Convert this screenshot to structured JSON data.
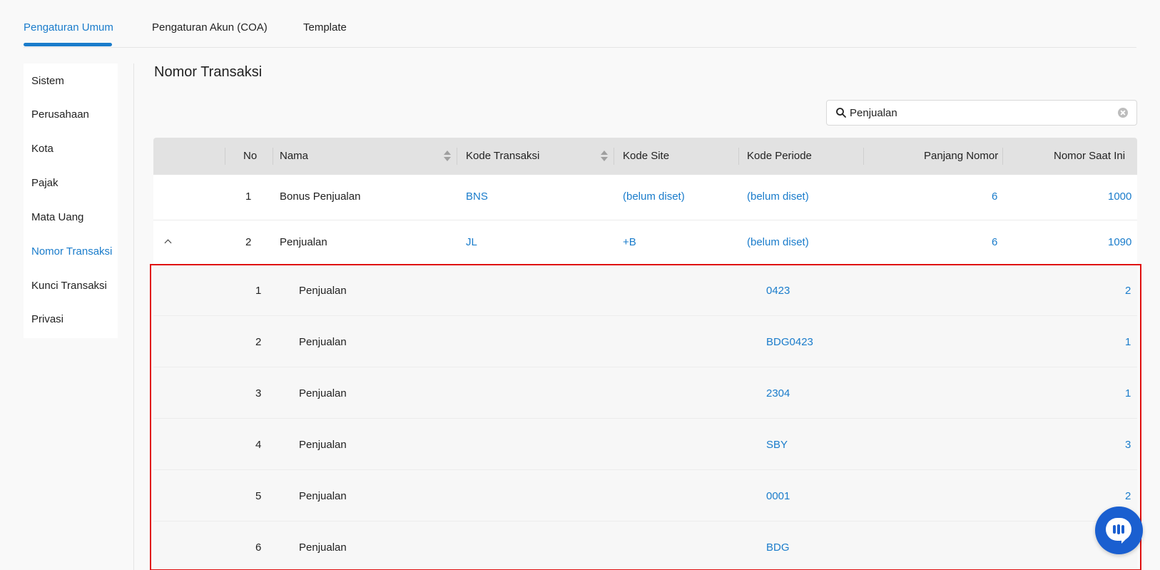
{
  "tabs": [
    {
      "label": "Pengaturan Umum",
      "active": true
    },
    {
      "label": "Pengaturan Akun (COA)",
      "active": false
    },
    {
      "label": "Template",
      "active": false
    }
  ],
  "sidebar": {
    "items": [
      {
        "label": "Sistem"
      },
      {
        "label": "Perusahaan"
      },
      {
        "label": "Kota"
      },
      {
        "label": "Pajak"
      },
      {
        "label": "Mata Uang"
      },
      {
        "label": "Nomor Transaksi",
        "active": true
      },
      {
        "label": "Kunci Transaksi"
      },
      {
        "label": "Privasi"
      }
    ]
  },
  "main": {
    "title": "Nomor Transaksi",
    "search": {
      "value": "Penjualan",
      "icon": "search-icon"
    }
  },
  "table": {
    "headers": {
      "no": "No",
      "nama": "Nama",
      "kode_transaksi": "Kode Transaksi",
      "kode_site": "Kode Site",
      "kode_periode": "Kode Periode",
      "panjang_nomor": "Panjang Nomor",
      "nomor_saat_ini": "Nomor Saat Ini"
    },
    "rows": [
      {
        "no": "1",
        "nama": "Bonus Penjualan",
        "kode_transaksi": "BNS",
        "kode_site": "(belum diset)",
        "kode_periode": "(belum diset)",
        "panjang_nomor": "6",
        "nomor_saat_ini": "1000"
      },
      {
        "no": "2",
        "nama": "Penjualan",
        "kode_transaksi": "JL",
        "kode_site": "+B",
        "kode_periode": "(belum diset)",
        "panjang_nomor": "6",
        "nomor_saat_ini": "1090",
        "expanded": true
      }
    ],
    "subrows": [
      {
        "no": "1",
        "nama": "Penjualan",
        "kode": "0423",
        "nomor": "2"
      },
      {
        "no": "2",
        "nama": "Penjualan",
        "kode": "BDG0423",
        "nomor": "1"
      },
      {
        "no": "3",
        "nama": "Penjualan",
        "kode": "2304",
        "nomor": "1"
      },
      {
        "no": "4",
        "nama": "Penjualan",
        "kode": "SBY",
        "nomor": "3"
      },
      {
        "no": "5",
        "nama": "Penjualan",
        "kode": "0001",
        "nomor": "2"
      },
      {
        "no": "6",
        "nama": "Penjualan",
        "kode": "BDG",
        "nomor": ""
      }
    ]
  },
  "colors": {
    "accent": "#1a7ccb",
    "highlight": "#e01010",
    "chat": "#1a5fd0"
  }
}
